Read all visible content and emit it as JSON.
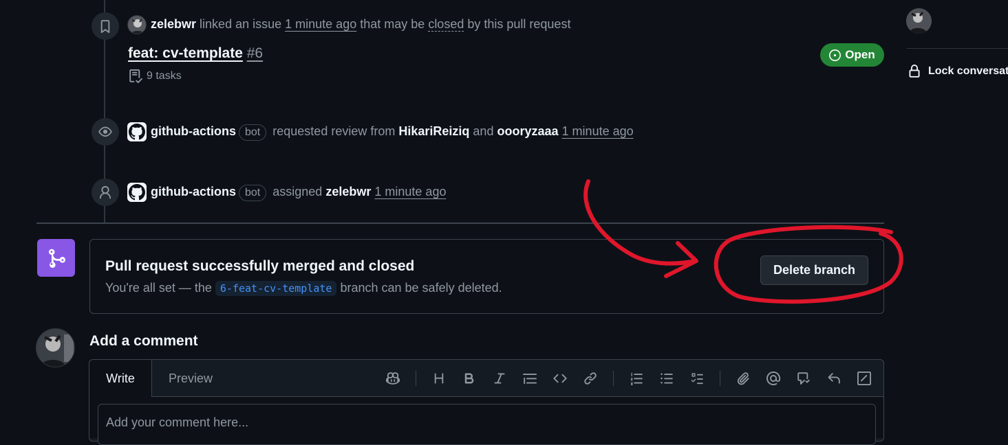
{
  "timeline": {
    "linked": {
      "user": "zelebwr",
      "action": "linked an issue",
      "time": "1 minute ago",
      "rest1": "that may be",
      "closed": "closed",
      "rest2": "by this pull request"
    },
    "issue": {
      "title": "feat: cv-template",
      "number": "#6",
      "tasks": "9 tasks",
      "status": "Open"
    },
    "review": {
      "actor": "github-actions",
      "bot": "bot",
      "action": "requested review from",
      "reviewer1": "HikariReiziq",
      "and": "and",
      "reviewer2": "oooryzaaa",
      "time": "1 minute ago"
    },
    "assign": {
      "actor": "github-actions",
      "bot": "bot",
      "action": "assigned",
      "assignee": "zelebwr",
      "time": "1 minute ago"
    }
  },
  "merge": {
    "title": "Pull request successfully merged and closed",
    "desc_before": "You're all set — the",
    "branch": "6-feat-cv-template",
    "desc_after": "branch can be safely deleted.",
    "button": "Delete branch"
  },
  "comment": {
    "heading": "Add a comment",
    "tab_write": "Write",
    "tab_preview": "Preview",
    "placeholder": "Add your comment here..."
  },
  "sidebar": {
    "lock": "Lock conversation"
  },
  "colors": {
    "open": "#238636",
    "merged": "#8957e5",
    "annotation": "#e0162b"
  }
}
